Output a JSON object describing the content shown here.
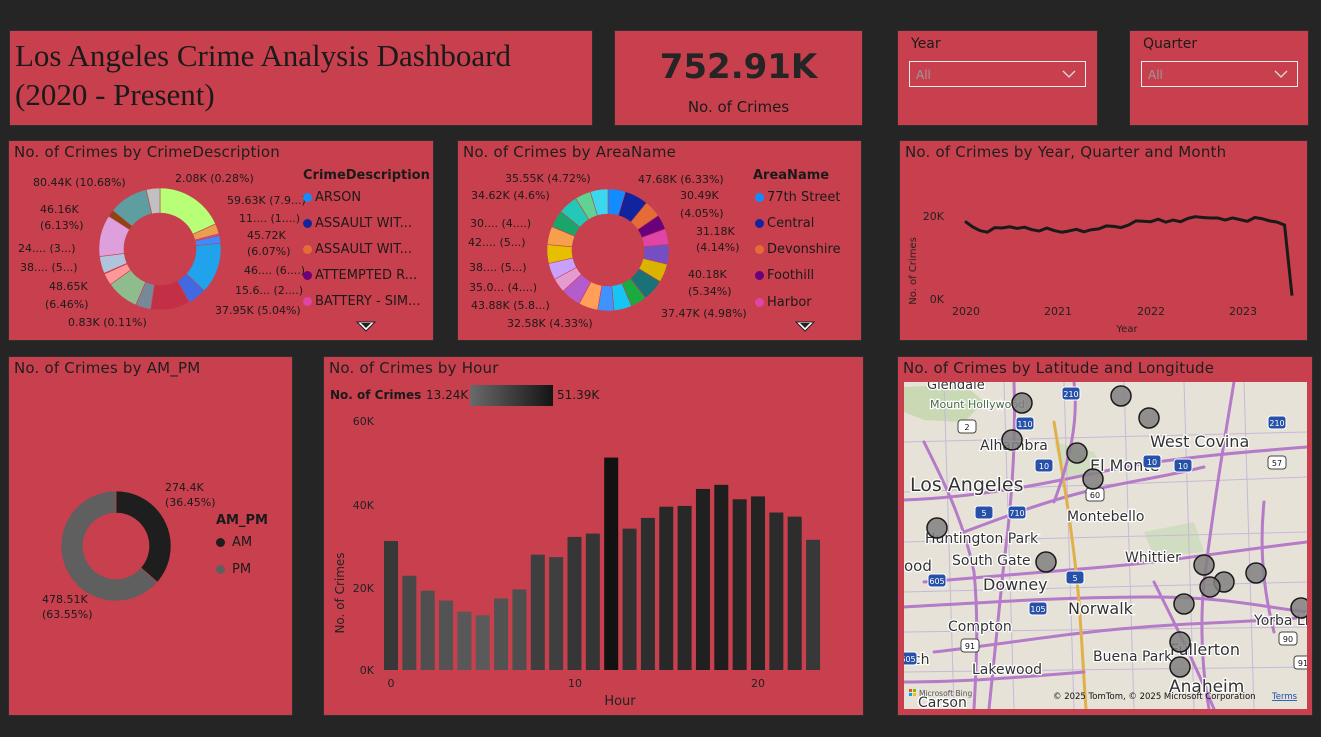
{
  "title": {
    "line1": "Los Angeles Crime Analysis Dashboard",
    "line2": "(2020 - Present)"
  },
  "kpi": {
    "value": "752.91K",
    "label": "No. of Crimes"
  },
  "slicers": [
    {
      "title": "Year",
      "value": "All"
    },
    {
      "title": "Quarter",
      "value": "All"
    }
  ],
  "crime_desc": {
    "title": "No. of Crimes by CrimeDescription",
    "legend_title": "CrimeDescription",
    "legend": [
      {
        "label": "ARSON",
        "color": "#118dff"
      },
      {
        "label": "ASSAULT WIT...",
        "color": "#12239e"
      },
      {
        "label": "ASSAULT WIT...",
        "color": "#e66c37"
      },
      {
        "label": "ATTEMPTED R...",
        "color": "#6b007b"
      },
      {
        "label": "BATTERY - SIM...",
        "color": "#e044a7"
      }
    ],
    "labels": [
      "80.44K (10.68%)",
      "2.08K (0.28%)",
      "59.63K (7.9...)",
      "11.... (1....)",
      "45.72K",
      "(6.07%)",
      "46.... (6....)",
      "15.6... (2....)",
      "37.95K (5.04%)",
      "0.83K (0.11%)",
      "48.65K",
      "(6.46%)",
      "38.... (5...)",
      "24.... (3...)",
      "46.16K",
      "(6.13%)"
    ]
  },
  "area": {
    "title": "No. of Crimes by AreaName",
    "legend_title": "AreaName",
    "legend": [
      {
        "label": "77th Street",
        "color": "#118dff"
      },
      {
        "label": "Central",
        "color": "#12239e"
      },
      {
        "label": "Devonshire",
        "color": "#e66c37"
      },
      {
        "label": "Foothill",
        "color": "#6b007b"
      },
      {
        "label": "Harbor",
        "color": "#e044a7"
      }
    ],
    "labels": [
      "35.55K (4.72%)",
      "47.68K (6.33%)",
      "34.62K (4.6%)",
      "30.49K",
      "(4.05%)",
      "30.... (4....)",
      "31.18K",
      "(4.14%)",
      "42.... (5...)",
      "40.18K",
      "(5.34%)",
      "38.... (5...)",
      "35.0... (4....)",
      "37.47K (4.98%)",
      "43.88K (5.8...)",
      "32.58K (4.33%)"
    ]
  },
  "trend": {
    "title": "No. of Crimes by Year, Quarter and Month",
    "ylabel": "No. of Crimes",
    "xlabel": "Year",
    "yticks": [
      "20K",
      "0K"
    ],
    "xticks": [
      "2020",
      "2021",
      "2022",
      "2023"
    ]
  },
  "ampm": {
    "title": "No. of Crimes by AM_PM",
    "legend_title": "AM_PM",
    "legend": [
      {
        "label": "AM",
        "color": "#1e1e1e"
      },
      {
        "label": "PM",
        "color": "#5f5f5f"
      }
    ],
    "am_label": [
      "274.4K",
      "(36.45%)"
    ],
    "pm_label": [
      "478.51K",
      "(63.55%)"
    ]
  },
  "hour": {
    "title": "No. of Crimes by Hour",
    "legend_title": "No. of Crimes",
    "min_label": "13.24K",
    "max_label": "51.39K",
    "ylabel": "No. of Crimes",
    "xlabel": "Hour",
    "yticks": [
      "60K",
      "40K",
      "20K",
      "0K"
    ],
    "xticks": [
      "0",
      "10",
      "20"
    ]
  },
  "map": {
    "title": "No. of Crimes by Latitude and Longitude",
    "places": [
      {
        "name": "Glendale"
      },
      {
        "name": "Mount Hollywood"
      },
      {
        "name": "Alhambra"
      },
      {
        "name": "West Covina"
      },
      {
        "name": "El Monte"
      },
      {
        "name": "Los Angeles"
      },
      {
        "name": "Montebello"
      },
      {
        "name": "Huntington Park"
      },
      {
        "name": "South Gate"
      },
      {
        "name": "Whittier"
      },
      {
        "name": "Downey"
      },
      {
        "name": "Norwalk"
      },
      {
        "name": "Compton"
      },
      {
        "name": "Buena Park"
      },
      {
        "name": "Fullerton"
      },
      {
        "name": "Yorba Lin"
      },
      {
        "name": "Lakewood"
      },
      {
        "name": "Anaheim"
      },
      {
        "name": "Carson"
      },
      {
        "name": "ood"
      },
      {
        "name": "nch"
      }
    ],
    "shields": [
      "210",
      "2",
      "110",
      "210",
      "10",
      "10",
      "57",
      "60",
      "5",
      "710",
      "5",
      "105",
      "605",
      "91",
      "90",
      "91",
      "605",
      "10"
    ],
    "attribution": "© 2025 TomTom, © 2025 Microsoft Corporation",
    "terms": "Terms",
    "bing": "Microsoft Bing"
  },
  "chart_data": [
    {
      "type": "pie",
      "title": "No. of Crimes by CrimeDescription",
      "slices": [
        {
          "label": "80.44K (10.68%)",
          "value": 80.44
        },
        {
          "label": "2.08K (0.28%)",
          "value": 2.08
        },
        {
          "label": "59.63K (7.9...)",
          "value": 59.63
        },
        {
          "label": "45.72K (6.07%)",
          "value": 45.72
        },
        {
          "label": "37.95K (5.04%)",
          "value": 37.95
        },
        {
          "label": "0.83K (0.11%)",
          "value": 0.83
        },
        {
          "label": "48.65K (6.46%)",
          "value": 48.65
        },
        {
          "label": "46.16K (6.13%)",
          "value": 46.16
        }
      ]
    },
    {
      "type": "pie",
      "title": "No. of Crimes by AreaName",
      "slices": [
        {
          "label": "35.55K (4.72%)",
          "value": 35.55
        },
        {
          "label": "47.68K (6.33%)",
          "value": 47.68
        },
        {
          "label": "34.62K (4.6%)",
          "value": 34.62
        },
        {
          "label": "30.49K (4.05%)",
          "value": 30.49
        },
        {
          "label": "31.18K (4.14%)",
          "value": 31.18
        },
        {
          "label": "40.18K (5.34%)",
          "value": 40.18
        },
        {
          "label": "37.47K (4.98%)",
          "value": 37.47
        },
        {
          "label": "43.88K (5.8...)",
          "value": 43.88
        },
        {
          "label": "32.58K (4.33%)",
          "value": 32.58
        }
      ]
    },
    {
      "type": "line",
      "title": "No. of Crimes by Year, Quarter and Month",
      "xlabel": "Year",
      "ylabel": "No. of Crimes",
      "x": [
        "2020-01",
        "2020-02",
        "2020-03",
        "2020-04",
        "2020-05",
        "2020-06",
        "2020-07",
        "2020-08",
        "2020-09",
        "2020-10",
        "2020-11",
        "2020-12",
        "2021-01",
        "2021-02",
        "2021-03",
        "2021-04",
        "2021-05",
        "2021-06",
        "2021-07",
        "2021-08",
        "2021-09",
        "2021-10",
        "2021-11",
        "2021-12",
        "2022-01",
        "2022-02",
        "2022-03",
        "2022-04",
        "2022-05",
        "2022-06",
        "2022-07",
        "2022-08",
        "2022-09",
        "2022-10",
        "2022-11",
        "2022-12",
        "2023-01",
        "2023-02",
        "2023-03",
        "2023-04",
        "2023-05",
        "2023-06",
        "2023-07",
        "2023-08",
        "2023-09"
      ],
      "values": [
        18500,
        17200,
        16300,
        15900,
        17000,
        16900,
        17200,
        16800,
        17100,
        16500,
        16200,
        16900,
        16300,
        15900,
        16200,
        16600,
        16000,
        16500,
        16700,
        17400,
        17300,
        17000,
        17600,
        18600,
        18500,
        18400,
        19000,
        18300,
        18800,
        18400,
        19200,
        19600,
        19400,
        19300,
        19300,
        18800,
        19300,
        18900,
        18500,
        19400,
        19100,
        18600,
        18300,
        17600,
        800
      ],
      "ylim": [
        0,
        24000
      ]
    },
    {
      "type": "pie",
      "title": "No. of Crimes by AM_PM",
      "slices": [
        {
          "label": "AM",
          "value": 274.4,
          "text": "274.4K (36.45%)"
        },
        {
          "label": "PM",
          "value": 478.51,
          "text": "478.51K (63.55%)"
        }
      ]
    },
    {
      "type": "bar",
      "title": "No. of Crimes by Hour",
      "xlabel": "Hour",
      "ylabel": "No. of Crimes",
      "categories": [
        0,
        1,
        2,
        3,
        4,
        5,
        6,
        7,
        8,
        9,
        10,
        11,
        12,
        13,
        14,
        15,
        16,
        17,
        18,
        19,
        20,
        21,
        22,
        23
      ],
      "values": [
        31200,
        22800,
        19200,
        16800,
        14100,
        13240,
        17300,
        19500,
        27900,
        27300,
        32200,
        33000,
        51390,
        34200,
        36800,
        39500,
        39700,
        43800,
        44800,
        41300,
        42000,
        38100,
        37100,
        31500
      ],
      "ylim": [
        0,
        60000
      ]
    },
    {
      "type": "scatter",
      "title": "No. of Crimes by Latitude and Longitude",
      "points": 22
    }
  ]
}
